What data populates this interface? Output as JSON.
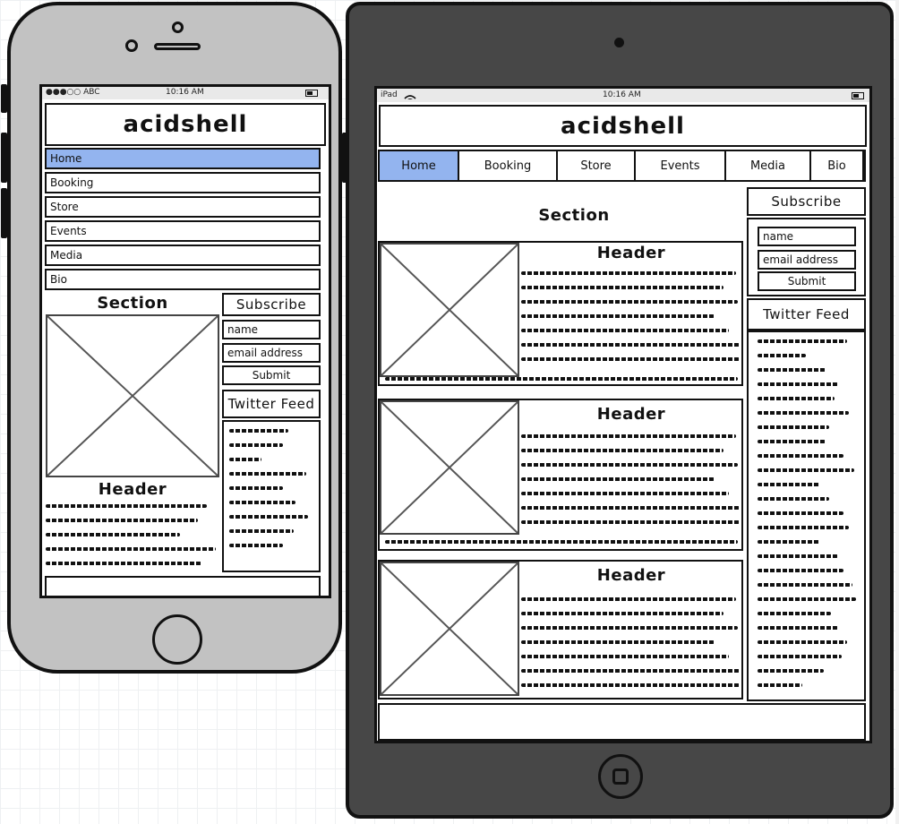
{
  "iphone": {
    "status": {
      "carrier": "●●●○○ ABC",
      "time": "10:16 AM"
    },
    "title": "acidshell",
    "nav": [
      "Home",
      "Booking",
      "Store",
      "Events",
      "Media",
      "Bio"
    ],
    "section_title": "Section",
    "article_header": "Header",
    "subscribe": {
      "title": "Subscribe",
      "name_placeholder": "name",
      "email_placeholder": "email address",
      "submit": "Submit"
    },
    "twitter_title": "Twitter Feed"
  },
  "ipad": {
    "status": {
      "device": "iPad",
      "time": "10:16 AM"
    },
    "title": "acidshell",
    "nav": [
      "Home",
      "Booking",
      "Store",
      "Events",
      "Media",
      "Bio"
    ],
    "section_title": "Section",
    "articles": [
      {
        "header": "Header"
      },
      {
        "header": "Header"
      },
      {
        "header": "Header"
      }
    ],
    "subscribe": {
      "title": "Subscribe",
      "name_placeholder": "name",
      "email_placeholder": "email address",
      "submit": "Submit"
    },
    "twitter_title": "Twitter Feed"
  },
  "colors": {
    "active_nav": "#93b4ef",
    "iphone_body": "#c2c2c2",
    "ipad_body": "#474747",
    "outline": "#111111"
  },
  "icons": [
    "battery-icon",
    "wifi-icon",
    "camera-icon",
    "speaker-icon",
    "home-button-icon",
    "image-placeholder-icon"
  ]
}
